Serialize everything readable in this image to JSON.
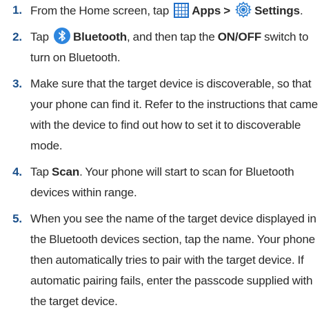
{
  "document": {
    "steps": [
      {
        "number": "1.",
        "text_a": "From the Home screen, tap ",
        "icon_1": "apps-grid-icon",
        "bold_a": "Apps > ",
        "icon_2": "settings-gear-icon",
        "bold_b": "Settings",
        "text_b": "."
      },
      {
        "number": "2.",
        "text_a": "Tap ",
        "icon_1": "bluetooth-icon",
        "bold_a": "Bluetooth",
        "text_b": ", and then tap the ",
        "bold_b": "ON/OFF",
        "text_c": " switch to turn on Bluetooth."
      },
      {
        "number": "3.",
        "text_a": "Make sure that the target device is discoverable, so that your phone can find it. Refer to the instructions that came with the device to find out how to set it to discoverable mode."
      },
      {
        "number": "4.",
        "text_a": "Tap ",
        "bold_a": "Scan",
        "text_b": ". Your phone will start to scan for Bluetooth devices within range."
      },
      {
        "number": "5.",
        "text_a": "When you see the name of the target device displayed in the Bluetooth devices section, tap the name. Your phone then automatically tries to pair with the target device. If automatic pairing fails, enter the passcode supplied with the target device."
      }
    ]
  },
  "colors": {
    "step_number": "#1a4f8a",
    "body_text": "#2a2a2a",
    "apps_icon": "#1f6fc9",
    "settings_icon": "#2b7fd3",
    "bluetooth_icon": "#2e86de"
  }
}
